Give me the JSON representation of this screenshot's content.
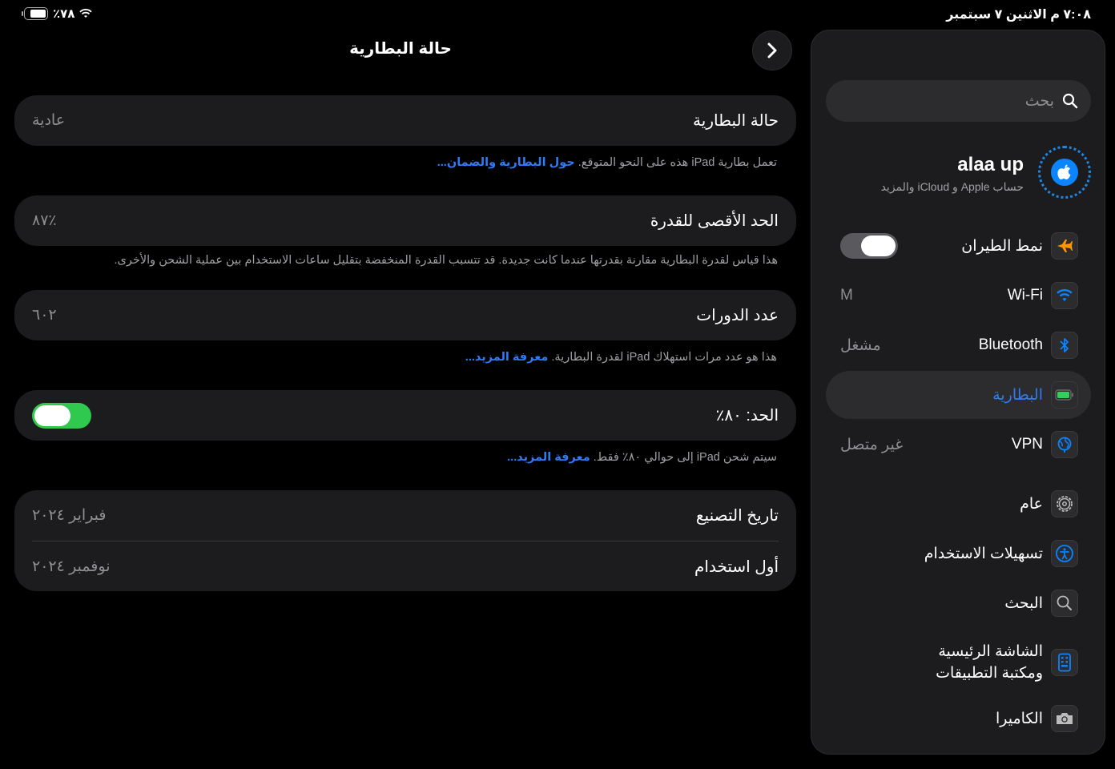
{
  "status": {
    "time": "٧:٠٨ م  الاثنين ٧ سبتمبر",
    "battery_pct": "٪٧٨",
    "battery_level": 0.78
  },
  "sidebar": {
    "search_placeholder": "بحث",
    "profile": {
      "name": "alaa up",
      "subtitle": "حساب Apple و iCloud والمزيد"
    },
    "items": [
      {
        "label": "نمط الطيران",
        "icon": "airplane-icon",
        "control": "toggle-off"
      },
      {
        "label": "Wi-Fi",
        "icon": "wifi-icon",
        "value": "M"
      },
      {
        "label": "Bluetooth",
        "icon": "bluetooth-icon",
        "value": "مشغل"
      },
      {
        "label": "البطارية",
        "icon": "battery-icon",
        "selected": true
      },
      {
        "label": "VPN",
        "icon": "vpn-globe-icon",
        "value": "غير متصل"
      },
      {
        "label": "عام",
        "icon": "gear-icon"
      },
      {
        "label": "تسهيلات الاستخدام",
        "icon": "accessibility-icon"
      },
      {
        "label": "البحث",
        "icon": "search-icon"
      },
      {
        "label": "الشاشة الرئيسية",
        "label2": "ومكتبة التطبيقات",
        "icon": "home-screen-icon"
      },
      {
        "label": "الكاميرا",
        "icon": "camera-icon"
      }
    ]
  },
  "main": {
    "title": "حالة البطارية",
    "battery_health": {
      "label": "حالة البطارية",
      "value": "عادية"
    },
    "note1": {
      "text": "تعمل بطارية iPad هذه على النحو المتوقع.",
      "link": "حول البطارية والضمان..."
    },
    "max_capacity": {
      "label": "الحد الأقصى للقدرة",
      "value": "٪٨٧"
    },
    "note2": {
      "text": "هذا قياس لقدرة البطارية مقارنة بقدرتها عندما كانت جديدة. قد تتسبب القدرة المنخفضة بتقليل ساعات الاستخدام بين عملية الشحن والأخرى."
    },
    "cycle_count": {
      "label": "عدد الدورات",
      "value": "٦٠٢"
    },
    "note3": {
      "text": "هذا هو عدد مرات استهلاك iPad لقدرة البطارية.",
      "link": "معرفة المزيد..."
    },
    "limit": {
      "label": "الحد: ٨٠٪",
      "toggle_on": true
    },
    "note4": {
      "text": "سيتم شحن iPad إلى حوالي ٨٠٪ فقط.",
      "link": "معرفة المزيد..."
    },
    "manufacture_date": {
      "label": "تاريخ التصنيع",
      "value": "فبراير ٢٠٢٤"
    },
    "first_use": {
      "label": "أول استخدام",
      "value": "نوفمبر ٢٠٢٤"
    }
  },
  "colors": {
    "accent_blue": "#2f7bf5",
    "toggle_green": "#30c94f",
    "airplane_orange": "#ff9500",
    "battery_green": "#30d158"
  }
}
